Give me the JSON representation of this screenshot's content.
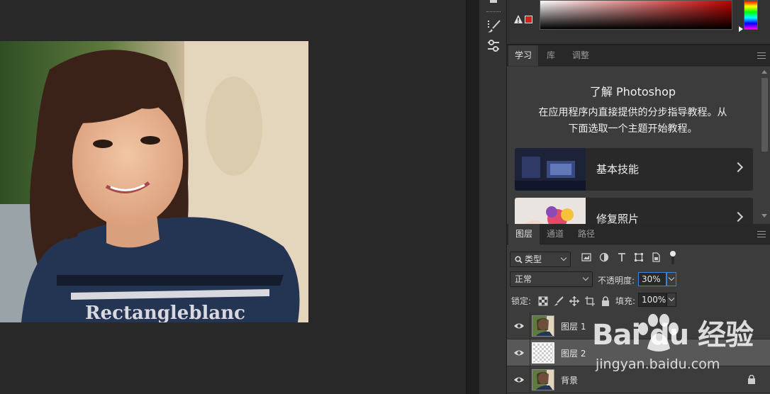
{
  "color_panel": {
    "warn_swatch_color": "#d22020",
    "icons": [
      "gamut-warning-icon",
      "color-swatch"
    ]
  },
  "tool_strip": {
    "icons": [
      "panel-icon",
      "brush-settings-icon",
      "adjustments-sliders-icon"
    ]
  },
  "learn_tabs": {
    "tabs": [
      {
        "label": "学习",
        "active": true
      },
      {
        "label": "库",
        "active": false
      },
      {
        "label": "调整",
        "active": false
      }
    ]
  },
  "learn": {
    "title": "了解 Photoshop",
    "description_line1": "在应用程序内直接提供的分步指导教程。从",
    "description_line2": "下面选取一个主题开始教程。",
    "lessons": [
      {
        "label": "基本技能"
      },
      {
        "label": "修复照片"
      }
    ]
  },
  "layers_tabs": {
    "tabs": [
      {
        "label": "图层",
        "active": true
      },
      {
        "label": "通道",
        "active": false
      },
      {
        "label": "路径",
        "active": false
      }
    ]
  },
  "layers": {
    "filter_type": "类型",
    "blend_mode": "正常",
    "opacity_label": "不透明度:",
    "opacity_value": "30%",
    "lock_label": "锁定:",
    "fill_label": "填充:",
    "fill_value": "100%",
    "items": [
      {
        "name": "图层 1",
        "visible": true,
        "selected": false,
        "locked": false
      },
      {
        "name": "图层 2",
        "visible": true,
        "selected": true,
        "locked": false
      },
      {
        "name": "背景",
        "visible": true,
        "selected": false,
        "locked": true
      }
    ]
  },
  "watermark": {
    "logo_text": "Bai du 经验",
    "url": "jingyan.baidu.com"
  }
}
